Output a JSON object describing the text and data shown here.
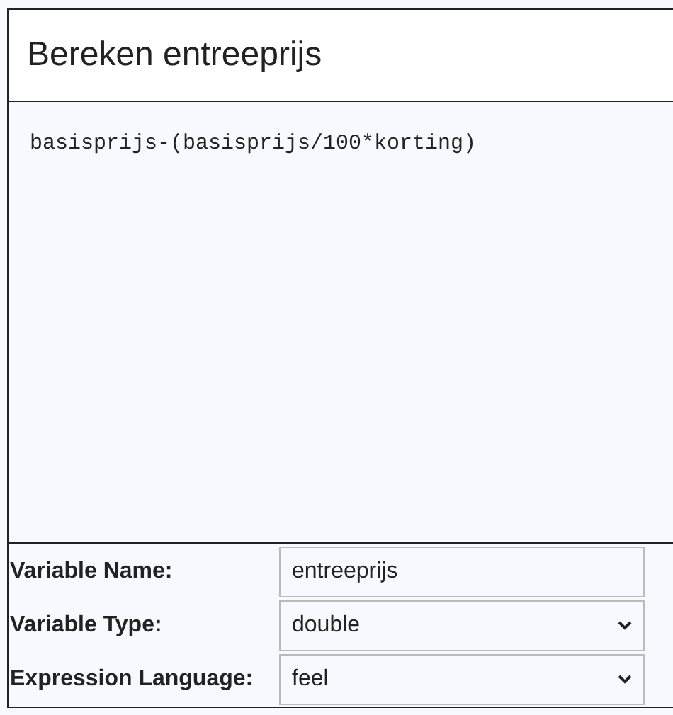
{
  "title": "Bereken entreeprijs",
  "expression": "basisprijs-(basisprijs/100*korting)",
  "fields": [
    {
      "label": "Variable Name:",
      "kind": "text",
      "value": "entreeprijs"
    },
    {
      "label": "Variable Type:",
      "kind": "select",
      "value": "double"
    },
    {
      "label": "Expression Language:",
      "kind": "select",
      "value": "feel"
    }
  ]
}
